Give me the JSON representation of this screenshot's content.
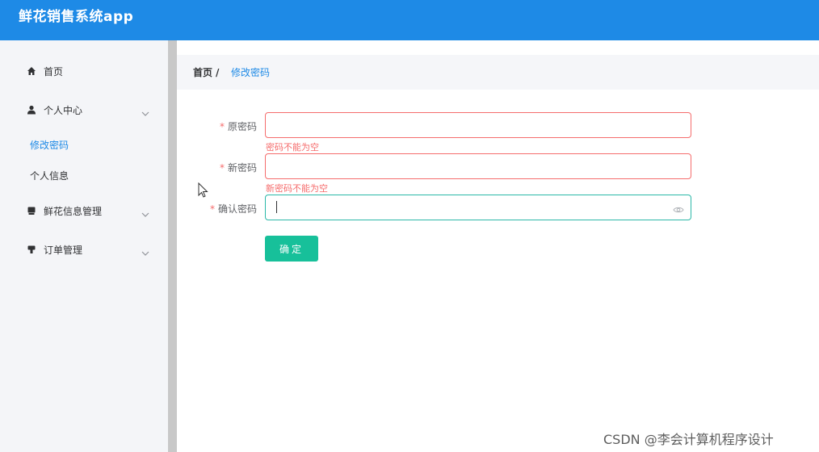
{
  "header": {
    "app_title": "鲜花销售系统app"
  },
  "sidebar": {
    "items": [
      {
        "label": "首页",
        "icon": "home-icon"
      },
      {
        "label": "个人中心",
        "icon": "user-icon",
        "expanded": true,
        "children": [
          {
            "label": "修改密码",
            "active": true
          },
          {
            "label": "个人信息",
            "active": false
          }
        ]
      },
      {
        "label": "鲜花信息管理",
        "icon": "box-icon"
      },
      {
        "label": "订单管理",
        "icon": "order-icon"
      }
    ]
  },
  "breadcrumb": {
    "home": "首页",
    "separator": "/",
    "current": "修改密码"
  },
  "form": {
    "required_mark": "*",
    "old_password": {
      "label": "原密码",
      "value": "",
      "error": "密码不能为空"
    },
    "new_password": {
      "label": "新密码",
      "value": "",
      "error": "新密码不能为空"
    },
    "confirm_password": {
      "label": "确认密码",
      "value": ""
    },
    "submit_label": "确定"
  },
  "watermark": "CSDN @李会计算机程序设计",
  "colors": {
    "primary": "#1e8ae6",
    "error": "#f56c6c",
    "success": "#17c09a",
    "focus": "#2bb8a8"
  }
}
